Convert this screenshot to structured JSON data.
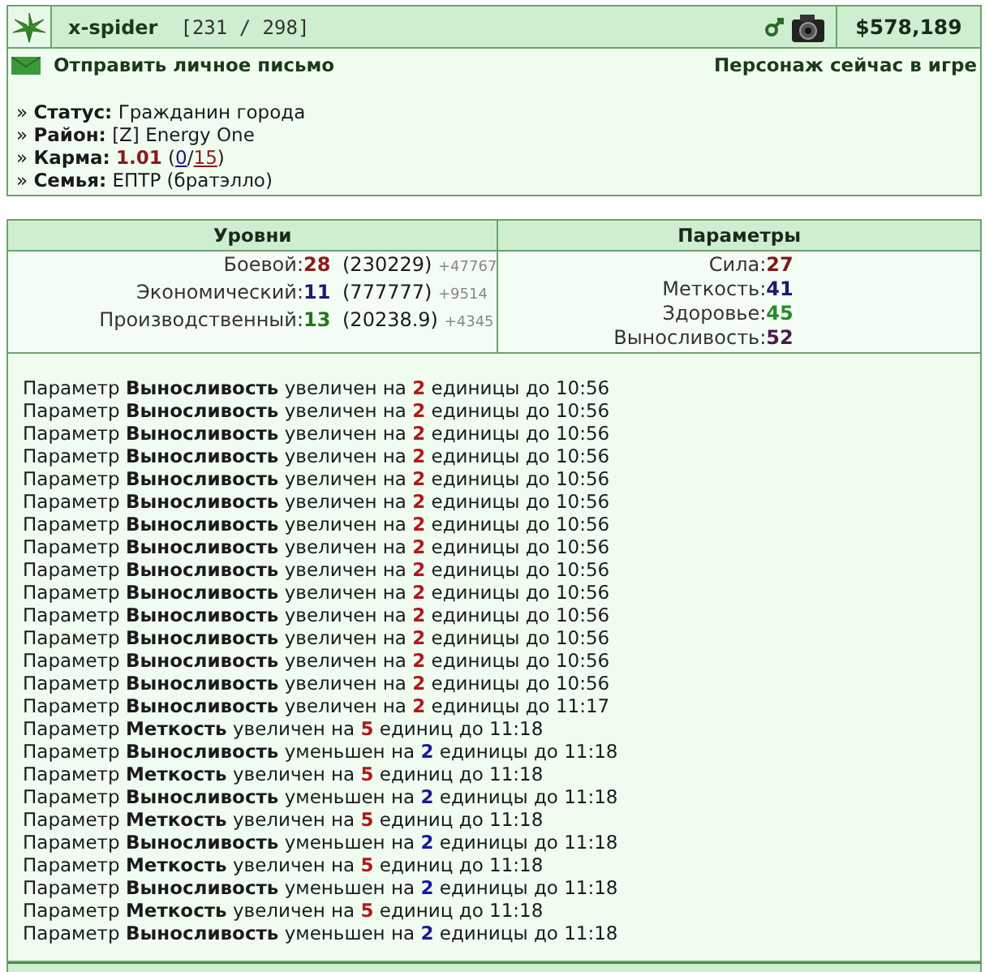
{
  "header": {
    "name": "x-spider",
    "level": "[231 / 298]",
    "money": "$578,189"
  },
  "actions": {
    "send_message": "Отправить личное письмо",
    "online_status": "Персонаж сейчас в игре"
  },
  "info": [
    {
      "kind": "plain",
      "bullet": "»",
      "label": "Статус:",
      "value": "Гражданин города"
    },
    {
      "kind": "plain",
      "bullet": "»",
      "label": "Район:",
      "value": "[Z] Energy One"
    },
    {
      "kind": "karma",
      "bullet": "»",
      "label": "Карма:",
      "value": "1.01",
      "open": "(",
      "link_1": "0",
      "separator": "/",
      "link_2": "15",
      "close": ")"
    },
    {
      "kind": "plain",
      "bullet": "»",
      "label": "Семья:",
      "value": "ЕПТР (братэлло)"
    }
  ],
  "levels": {
    "title": "Уровни",
    "items": [
      {
        "label": "Боевой:",
        "value": "28",
        "color": "#8b1a1a",
        "detail": "(230229)",
        "gain": "+47767"
      },
      {
        "label": "Экономический:",
        "value": "11",
        "color": "#1a1a7a",
        "detail": "(777777)",
        "gain": "+9514"
      },
      {
        "label": "Производственный:",
        "value": "13",
        "color": "#1a7a1a",
        "detail": "(20238.9)",
        "gain": "+4345"
      }
    ]
  },
  "parameters": {
    "title": "Параметры",
    "items": [
      {
        "label": "Сила:",
        "value": "27",
        "color": "#7a1a1a"
      },
      {
        "label": "Меткость:",
        "value": "41",
        "color": "#1a1a6a"
      },
      {
        "label": "Здоровье:",
        "value": "45",
        "color": "#2a8a2a"
      },
      {
        "label": "Выносливость:",
        "value": "52",
        "color": "#4a1a4a"
      }
    ]
  },
  "log": [
    {
      "prefix": "Параметр",
      "param": "Выносливость",
      "verb": "увеличен на",
      "amount": "2",
      "increase": true,
      "rest": "единицы до 10:56"
    },
    {
      "prefix": "Параметр",
      "param": "Выносливость",
      "verb": "увеличен на",
      "amount": "2",
      "increase": true,
      "rest": "единицы до 10:56"
    },
    {
      "prefix": "Параметр",
      "param": "Выносливость",
      "verb": "увеличен на",
      "amount": "2",
      "increase": true,
      "rest": "единицы до 10:56"
    },
    {
      "prefix": "Параметр",
      "param": "Выносливость",
      "verb": "увеличен на",
      "amount": "2",
      "increase": true,
      "rest": "единицы до 10:56"
    },
    {
      "prefix": "Параметр",
      "param": "Выносливость",
      "verb": "увеличен на",
      "amount": "2",
      "increase": true,
      "rest": "единицы до 10:56"
    },
    {
      "prefix": "Параметр",
      "param": "Выносливость",
      "verb": "увеличен на",
      "amount": "2",
      "increase": true,
      "rest": "единицы до 10:56"
    },
    {
      "prefix": "Параметр",
      "param": "Выносливость",
      "verb": "увеличен на",
      "amount": "2",
      "increase": true,
      "rest": "единицы до 10:56"
    },
    {
      "prefix": "Параметр",
      "param": "Выносливость",
      "verb": "увеличен на",
      "amount": "2",
      "increase": true,
      "rest": "единицы до 10:56"
    },
    {
      "prefix": "Параметр",
      "param": "Выносливость",
      "verb": "увеличен на",
      "amount": "2",
      "increase": true,
      "rest": "единицы до 10:56"
    },
    {
      "prefix": "Параметр",
      "param": "Выносливость",
      "verb": "увеличен на",
      "amount": "2",
      "increase": true,
      "rest": "единицы до 10:56"
    },
    {
      "prefix": "Параметр",
      "param": "Выносливость",
      "verb": "увеличен на",
      "amount": "2",
      "increase": true,
      "rest": "единицы до 10:56"
    },
    {
      "prefix": "Параметр",
      "param": "Выносливость",
      "verb": "увеличен на",
      "amount": "2",
      "increase": true,
      "rest": "единицы до 10:56"
    },
    {
      "prefix": "Параметр",
      "param": "Выносливость",
      "verb": "увеличен на",
      "amount": "2",
      "increase": true,
      "rest": "единицы до 10:56"
    },
    {
      "prefix": "Параметр",
      "param": "Выносливость",
      "verb": "увеличен на",
      "amount": "2",
      "increase": true,
      "rest": "единицы до 10:56"
    },
    {
      "prefix": "Параметр",
      "param": "Выносливость",
      "verb": "увеличен на",
      "amount": "2",
      "increase": true,
      "rest": "единицы до 11:17"
    },
    {
      "prefix": "Параметр",
      "param": "Меткость",
      "verb": "увеличен на",
      "amount": "5",
      "increase": true,
      "rest": "единиц до 11:18"
    },
    {
      "prefix": "Параметр",
      "param": "Выносливость",
      "verb": "уменьшен на",
      "amount": "2",
      "increase": false,
      "rest": "единицы до 11:18"
    },
    {
      "prefix": "Параметр",
      "param": "Меткость",
      "verb": "увеличен на",
      "amount": "5",
      "increase": true,
      "rest": "единиц до 11:18"
    },
    {
      "prefix": "Параметр",
      "param": "Выносливость",
      "verb": "уменьшен на",
      "amount": "2",
      "increase": false,
      "rest": "единицы до 11:18"
    },
    {
      "prefix": "Параметр",
      "param": "Меткость",
      "verb": "увеличен на",
      "amount": "5",
      "increase": true,
      "rest": "единиц до 11:18"
    },
    {
      "prefix": "Параметр",
      "param": "Выносливость",
      "verb": "уменьшен на",
      "amount": "2",
      "increase": false,
      "rest": "единицы до 11:18"
    },
    {
      "prefix": "Параметр",
      "param": "Меткость",
      "verb": "увеличен на",
      "amount": "5",
      "increase": true,
      "rest": "единиц до 11:18"
    },
    {
      "prefix": "Параметр",
      "param": "Выносливость",
      "verb": "уменьшен на",
      "amount": "2",
      "increase": false,
      "rest": "единицы до 11:18"
    },
    {
      "prefix": "Параметр",
      "param": "Меткость",
      "verb": "увеличен на",
      "amount": "5",
      "increase": true,
      "rest": "единиц до 11:18"
    },
    {
      "prefix": "Параметр",
      "param": "Выносливость",
      "verb": "уменьшен на",
      "amount": "2",
      "increase": false,
      "rest": "единицы до 11:18"
    }
  ]
}
